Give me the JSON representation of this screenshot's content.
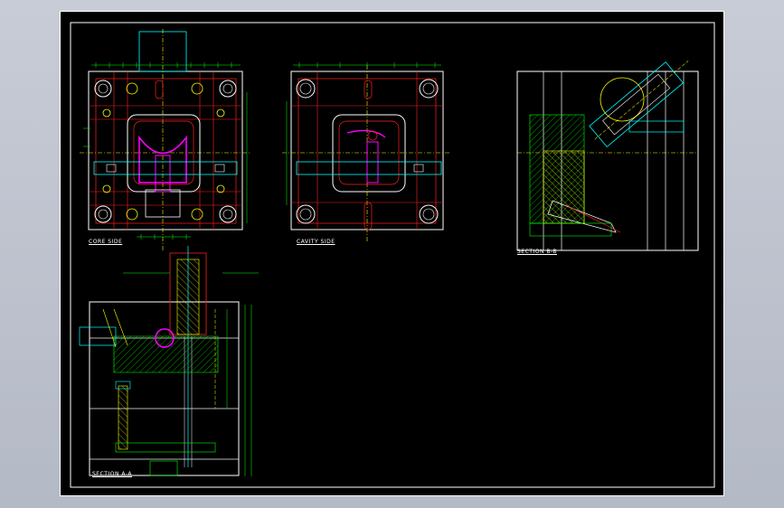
{
  "drawing": {
    "colors": {
      "sheet": "#000000",
      "border": "#ffffff",
      "red": "#ff2020",
      "yellow": "#ffff00",
      "green": "#00ff00",
      "cyan": "#00ffff",
      "magenta": "#ff00ff",
      "white": "#ffffff",
      "blue": "#4a4aff"
    },
    "views": {
      "core": {
        "label": "CORE SIDE"
      },
      "cavity": {
        "label": "CAVITY SIDE"
      },
      "section_bb": {
        "label": "SECTION B-B"
      },
      "section_aa": {
        "label": "SECTION A-A"
      }
    }
  }
}
